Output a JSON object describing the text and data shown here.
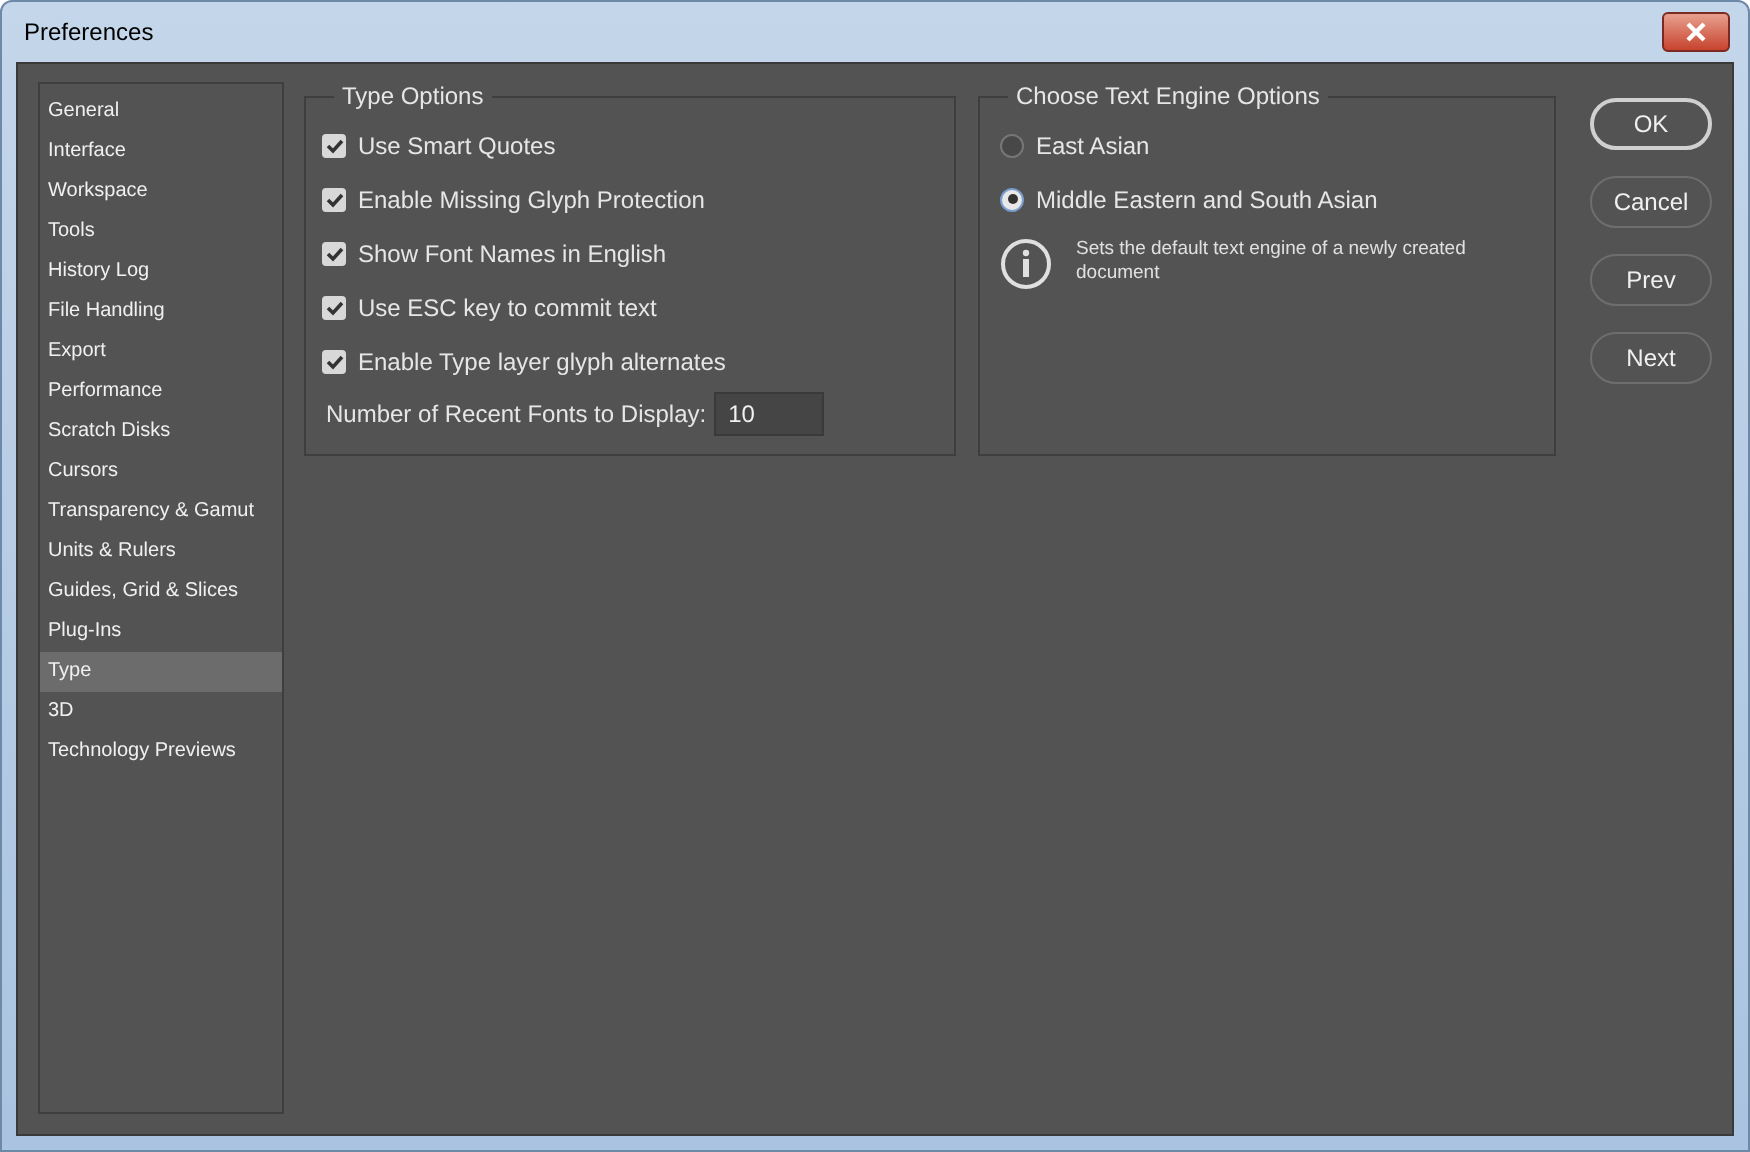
{
  "window": {
    "title": "Preferences"
  },
  "sidebar": {
    "items": [
      {
        "label": "General",
        "selected": false
      },
      {
        "label": "Interface",
        "selected": false
      },
      {
        "label": "Workspace",
        "selected": false
      },
      {
        "label": "Tools",
        "selected": false
      },
      {
        "label": "History Log",
        "selected": false
      },
      {
        "label": "File Handling",
        "selected": false
      },
      {
        "label": "Export",
        "selected": false
      },
      {
        "label": "Performance",
        "selected": false
      },
      {
        "label": "Scratch Disks",
        "selected": false
      },
      {
        "label": "Cursors",
        "selected": false
      },
      {
        "label": "Transparency & Gamut",
        "selected": false
      },
      {
        "label": "Units & Rulers",
        "selected": false
      },
      {
        "label": "Guides, Grid & Slices",
        "selected": false
      },
      {
        "label": "Plug-Ins",
        "selected": false
      },
      {
        "label": "Type",
        "selected": true
      },
      {
        "label": "3D",
        "selected": false
      },
      {
        "label": "Technology Previews",
        "selected": false
      }
    ]
  },
  "type_options": {
    "title": "Type Options",
    "checkboxes": [
      {
        "label": "Use Smart Quotes",
        "checked": true
      },
      {
        "label": "Enable Missing Glyph Protection",
        "checked": true
      },
      {
        "label": "Show Font Names in English",
        "checked": true
      },
      {
        "label": "Use ESC key to commit text",
        "checked": true
      },
      {
        "label": "Enable Type layer glyph alternates",
        "checked": true
      }
    ],
    "recent_fonts": {
      "label": "Number of Recent Fonts to Display:",
      "value": "10"
    }
  },
  "text_engine": {
    "title": "Choose Text Engine Options",
    "radios": [
      {
        "label": "East Asian",
        "selected": false
      },
      {
        "label": "Middle Eastern and South Asian",
        "selected": true
      }
    ],
    "info": "Sets the default text engine of a newly created document"
  },
  "buttons": [
    {
      "label": "OK",
      "default": true
    },
    {
      "label": "Cancel",
      "default": false
    },
    {
      "label": "Prev",
      "default": false
    },
    {
      "label": "Next",
      "default": false
    }
  ]
}
